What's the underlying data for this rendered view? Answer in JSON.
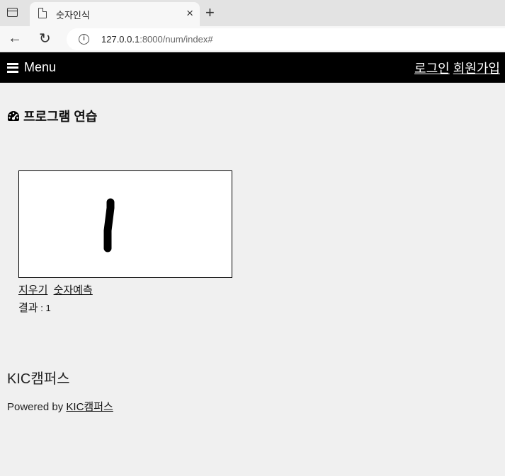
{
  "browser": {
    "tab_title": "숫자인식",
    "tab_close": "×",
    "new_tab": "+",
    "url_host": "127.0.0.1",
    "url_path": ":8000/num/index#",
    "back_icon": "←",
    "reload_icon": "↻"
  },
  "topbar": {
    "menu_label": "Menu",
    "login": "로그인",
    "signup": "회원가입"
  },
  "main": {
    "title": "프로그램 연습",
    "canvas": {
      "stroke_color": "#000000",
      "background": "#ffffff"
    },
    "clear_link": "지우기",
    "predict_link": "숫자예측",
    "result_label": "결과",
    "result_sep": " : ",
    "result_value": "1"
  },
  "footer": {
    "brand": "KIC캠퍼스",
    "powered_by": "Powered by ",
    "powered_link": "KIC캠퍼스"
  }
}
